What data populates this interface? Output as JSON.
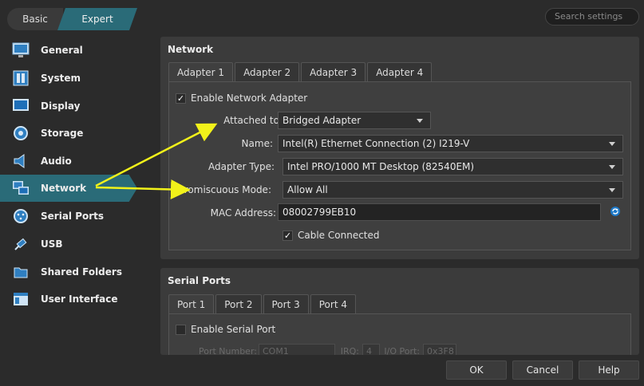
{
  "modes": {
    "basic": "Basic",
    "expert": "Expert"
  },
  "search": {
    "placeholder": "Search settings"
  },
  "sidebar": {
    "items": [
      {
        "label": "General",
        "icon": "monitor-icon"
      },
      {
        "label": "System",
        "icon": "chip-icon"
      },
      {
        "label": "Display",
        "icon": "display-icon"
      },
      {
        "label": "Storage",
        "icon": "disk-icon"
      },
      {
        "label": "Audio",
        "icon": "speaker-icon"
      },
      {
        "label": "Network",
        "icon": "network-icon",
        "active": true
      },
      {
        "label": "Serial Ports",
        "icon": "serial-port-icon"
      },
      {
        "label": "USB",
        "icon": "usb-icon"
      },
      {
        "label": "Shared Folders",
        "icon": "folder-icon"
      },
      {
        "label": "User Interface",
        "icon": "window-icon"
      }
    ]
  },
  "network": {
    "title": "Network",
    "tabs": [
      "Adapter 1",
      "Adapter 2",
      "Adapter 3",
      "Adapter 4"
    ],
    "enable_label": "Enable Network Adapter",
    "enable_checked": true,
    "attached_label": "Attached to:",
    "attached_value": "Bridged Adapter",
    "name_label": "Name:",
    "name_value": "Intel(R) Ethernet Connection (2) I219-V",
    "adapter_type_label": "Adapter Type:",
    "adapter_type_value": "Intel PRO/1000 MT Desktop (82540EM)",
    "promiscuous_label": "Promiscuous Mode:",
    "promiscuous_value": "Allow All",
    "mac_label": "MAC Address:",
    "mac_value": "08002799EB10",
    "cable_label": "Cable Connected",
    "cable_checked": true
  },
  "serial": {
    "title": "Serial Ports",
    "tabs": [
      "Port 1",
      "Port 2",
      "Port 3",
      "Port 4"
    ],
    "enable_label": "Enable Serial Port",
    "port_number_label": "Port Number:",
    "port_number_value": "COM1",
    "irq_label": "IRQ:",
    "irq_value": "4",
    "io_port_label": "I/O Port:",
    "io_port_value": "0x3F8"
  },
  "footer": {
    "ok": "OK",
    "cancel": "Cancel",
    "help": "Help"
  },
  "colors": {
    "accent": "#2a6b78",
    "arrow": "#f2f21a"
  }
}
